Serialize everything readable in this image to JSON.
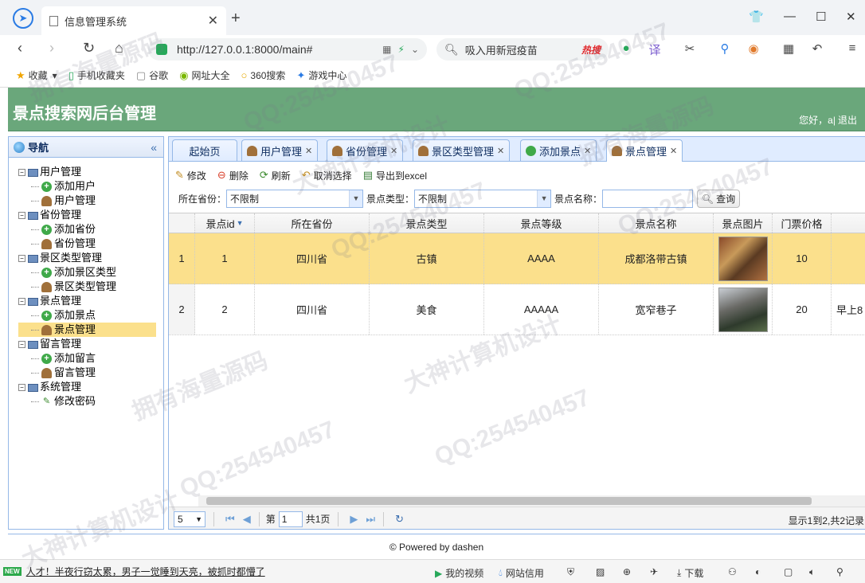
{
  "browser": {
    "tab_title": "信息管理系统",
    "url": "http://127.0.0.1:8000/main#",
    "search_text": "吸入用新冠疫苗",
    "search_hot": "热搜",
    "bookmarks": [
      "收藏",
      "手机收藏夹",
      "谷歌",
      "网址大全",
      "360搜索",
      "游戏中心"
    ]
  },
  "header": {
    "title": "景点搜索网后台管理",
    "greeting": "您好，a",
    "logout": "退出"
  },
  "sidebar": {
    "title": "导航",
    "groups": [
      {
        "label": "用户管理",
        "items": [
          "添加用户",
          "用户管理"
        ]
      },
      {
        "label": "省份管理",
        "items": [
          "添加省份",
          "省份管理"
        ]
      },
      {
        "label": "景区类型管理",
        "items": [
          "添加景区类型",
          "景区类型管理"
        ]
      },
      {
        "label": "景点管理",
        "items": [
          "添加景点",
          "景点管理"
        ]
      },
      {
        "label": "留言管理",
        "items": [
          "添加留言",
          "留言管理"
        ]
      },
      {
        "label": "系统管理",
        "items": [
          "修改密码"
        ]
      }
    ]
  },
  "tabs": [
    "起始页",
    "用户管理",
    "省份管理",
    "景区类型管理",
    "添加景点",
    "景点管理"
  ],
  "toolbar": {
    "edit": "修改",
    "delete": "删除",
    "refresh": "刷新",
    "unselect": "取消选择",
    "export": "导出到excel"
  },
  "filter": {
    "province_label": "所在省份：",
    "province_value": "不限制",
    "type_label": "景点类型：",
    "type_value": "不限制",
    "name_label": "景点名称：",
    "query": "查询"
  },
  "grid": {
    "columns": [
      "景点id",
      "所在省份",
      "景点类型",
      "景点等级",
      "景点名称",
      "景点图片",
      "门票价格",
      ""
    ],
    "rows": [
      {
        "num": "1",
        "id": "1",
        "province": "四川省",
        "type": "古镇",
        "level": "AAAA",
        "name": "成都洛带古镇",
        "price": "10",
        "extra": ""
      },
      {
        "num": "2",
        "id": "2",
        "province": "四川省",
        "type": "美食",
        "level": "AAAAA",
        "name": "宽窄巷子",
        "price": "20",
        "extra": "早上8"
      }
    ]
  },
  "pager": {
    "page_size": "5",
    "page_label_pre": "第",
    "page_value": "1",
    "page_label_post": "共1页",
    "info": "显示1到2,共2记录"
  },
  "footer": {
    "text": "© Powered by dashen"
  },
  "statusbar": {
    "news": "人才！半夜行窃太累，男子一觉睡到天亮，被抓时都懵了",
    "video": "我的视频",
    "credit": "网站信用",
    "download": "下载"
  },
  "watermarks": [
    "QQ:254540457",
    "大神计算机设计",
    "拥有海量源码"
  ]
}
